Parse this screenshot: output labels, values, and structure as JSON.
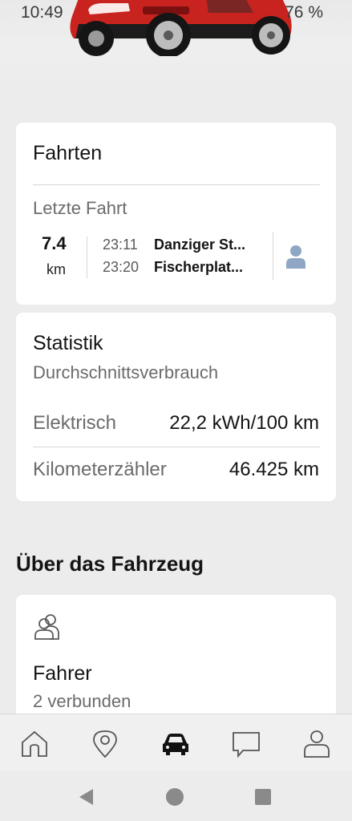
{
  "status_bar": {
    "time": "10:49",
    "battery": "76 %"
  },
  "trips_card": {
    "title": "Fahrten",
    "subtitle": "Letzte Fahrt",
    "distance_value": "7.4",
    "distance_unit": "km",
    "start_time": "23:11",
    "start_place": "Danziger St...",
    "end_time": "23:20",
    "end_place": "Fischerplat..."
  },
  "stats_card": {
    "title": "Statistik",
    "subtitle": "Durchschnittsverbrauch",
    "rows": [
      {
        "label": "Elektrisch",
        "value": "22,2 kWh/100 km"
      },
      {
        "label": "Kilometerzähler",
        "value": "46.425 km"
      }
    ]
  },
  "vehicle_section": {
    "heading": "Über das Fahrzeug",
    "drivers_card": {
      "title": "Fahrer",
      "subtitle": "2 verbunden"
    }
  },
  "bottom_nav": {
    "items": [
      {
        "icon": "home-icon",
        "active": false
      },
      {
        "icon": "map-pin-icon",
        "active": false
      },
      {
        "icon": "car-icon",
        "active": true
      },
      {
        "icon": "chat-icon",
        "active": false
      },
      {
        "icon": "profile-icon",
        "active": false
      }
    ]
  },
  "colors": {
    "background": "#ececec",
    "card": "#ffffff",
    "text_primary": "#141414",
    "text_secondary": "#6b6b6b",
    "avatar_accent": "#8fa7c4",
    "car_body": "#c8231e"
  }
}
